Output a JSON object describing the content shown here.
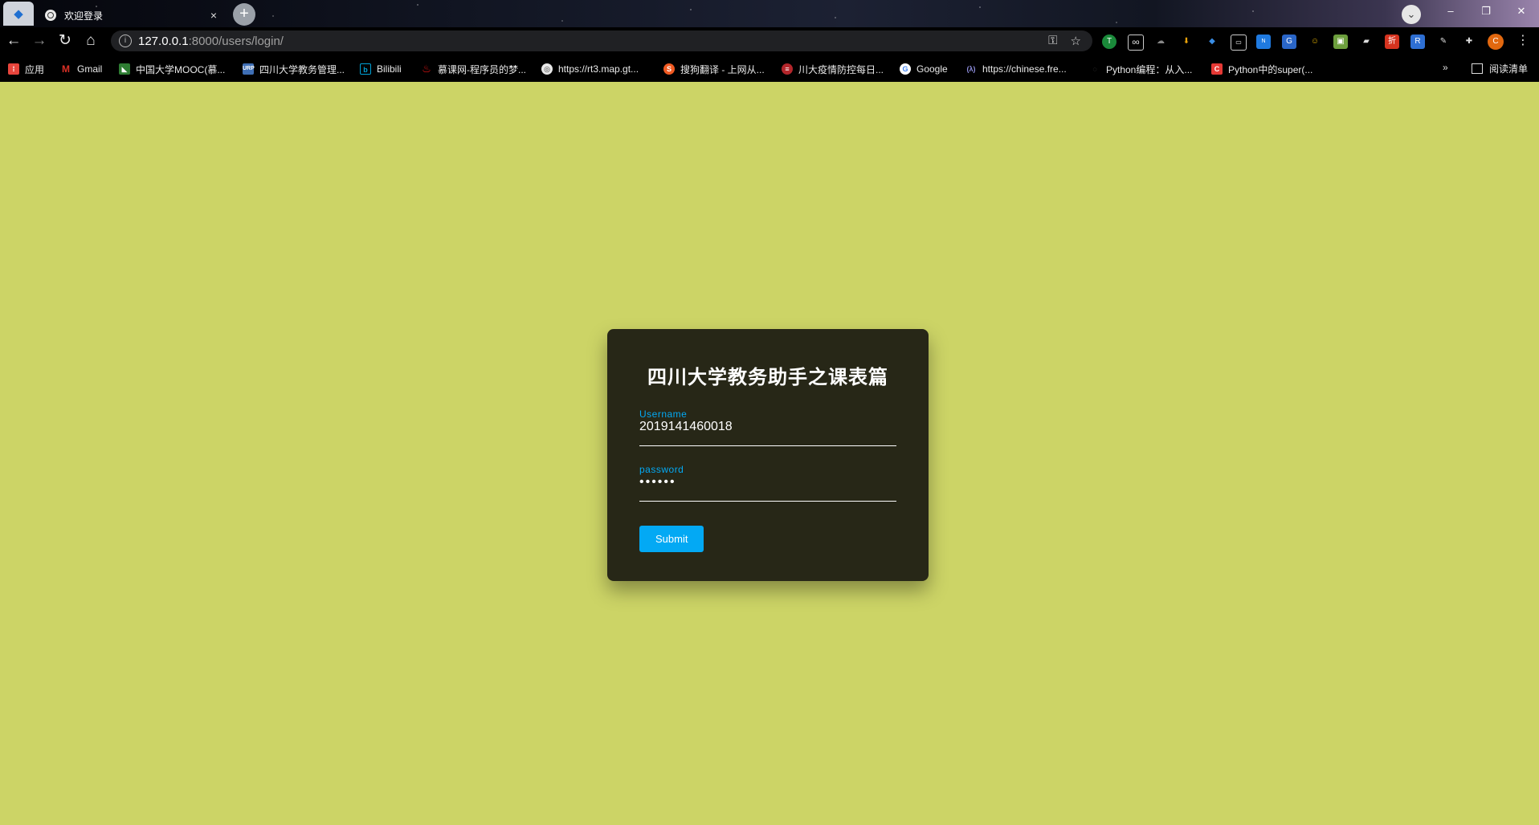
{
  "browser": {
    "tab_title": "欢迎登录",
    "tab_close": "×",
    "new_tab": "+",
    "url_host": "127.0.0.1",
    "url_path": ":8000/users/login/",
    "bookmarks": [
      {
        "label": "应用",
        "icon_color": "#e8453c"
      },
      {
        "label": "Gmail",
        "icon_color": "#d93025"
      },
      {
        "label": "中国大学MOOC(慕...",
        "icon_color": "#2e7d32"
      },
      {
        "label": "四川大学教务管理...",
        "icon_color": "#3f6fb5"
      },
      {
        "label": "Bilibili",
        "icon_color": "#00a1d6"
      },
      {
        "label": "慕课网-程序员的梦...",
        "icon_color": "#f01414"
      },
      {
        "label": "https://rt3.map.gt...",
        "icon_color": "#e8e8e8"
      },
      {
        "label": "搜狗翻译 - 上网从...",
        "icon_color": "#f15a22"
      },
      {
        "label": "川大疫情防控每日...",
        "icon_color": "#b3262b"
      },
      {
        "label": "Google",
        "icon_color": "#ffffff"
      },
      {
        "label": "https://chinese.fre...",
        "icon_color": "#5a5ac8"
      },
      {
        "label": "Python编程：从入...",
        "icon_color": "#333333"
      },
      {
        "label": "Python中的super(...",
        "icon_color": "#e53935"
      }
    ],
    "reading_list": "阅读清单",
    "more_bookmarks": "»",
    "profile_initial": "C"
  },
  "login": {
    "title": "四川大学教务助手之课表篇",
    "username_label": "Username",
    "username_value": "2019141460018",
    "password_label": "password",
    "password_value": "••••••",
    "submit_label": "Submit"
  },
  "colors": {
    "page_bg": "#ccd466",
    "card_bg": "#272717",
    "accent": "#03a9f4"
  }
}
